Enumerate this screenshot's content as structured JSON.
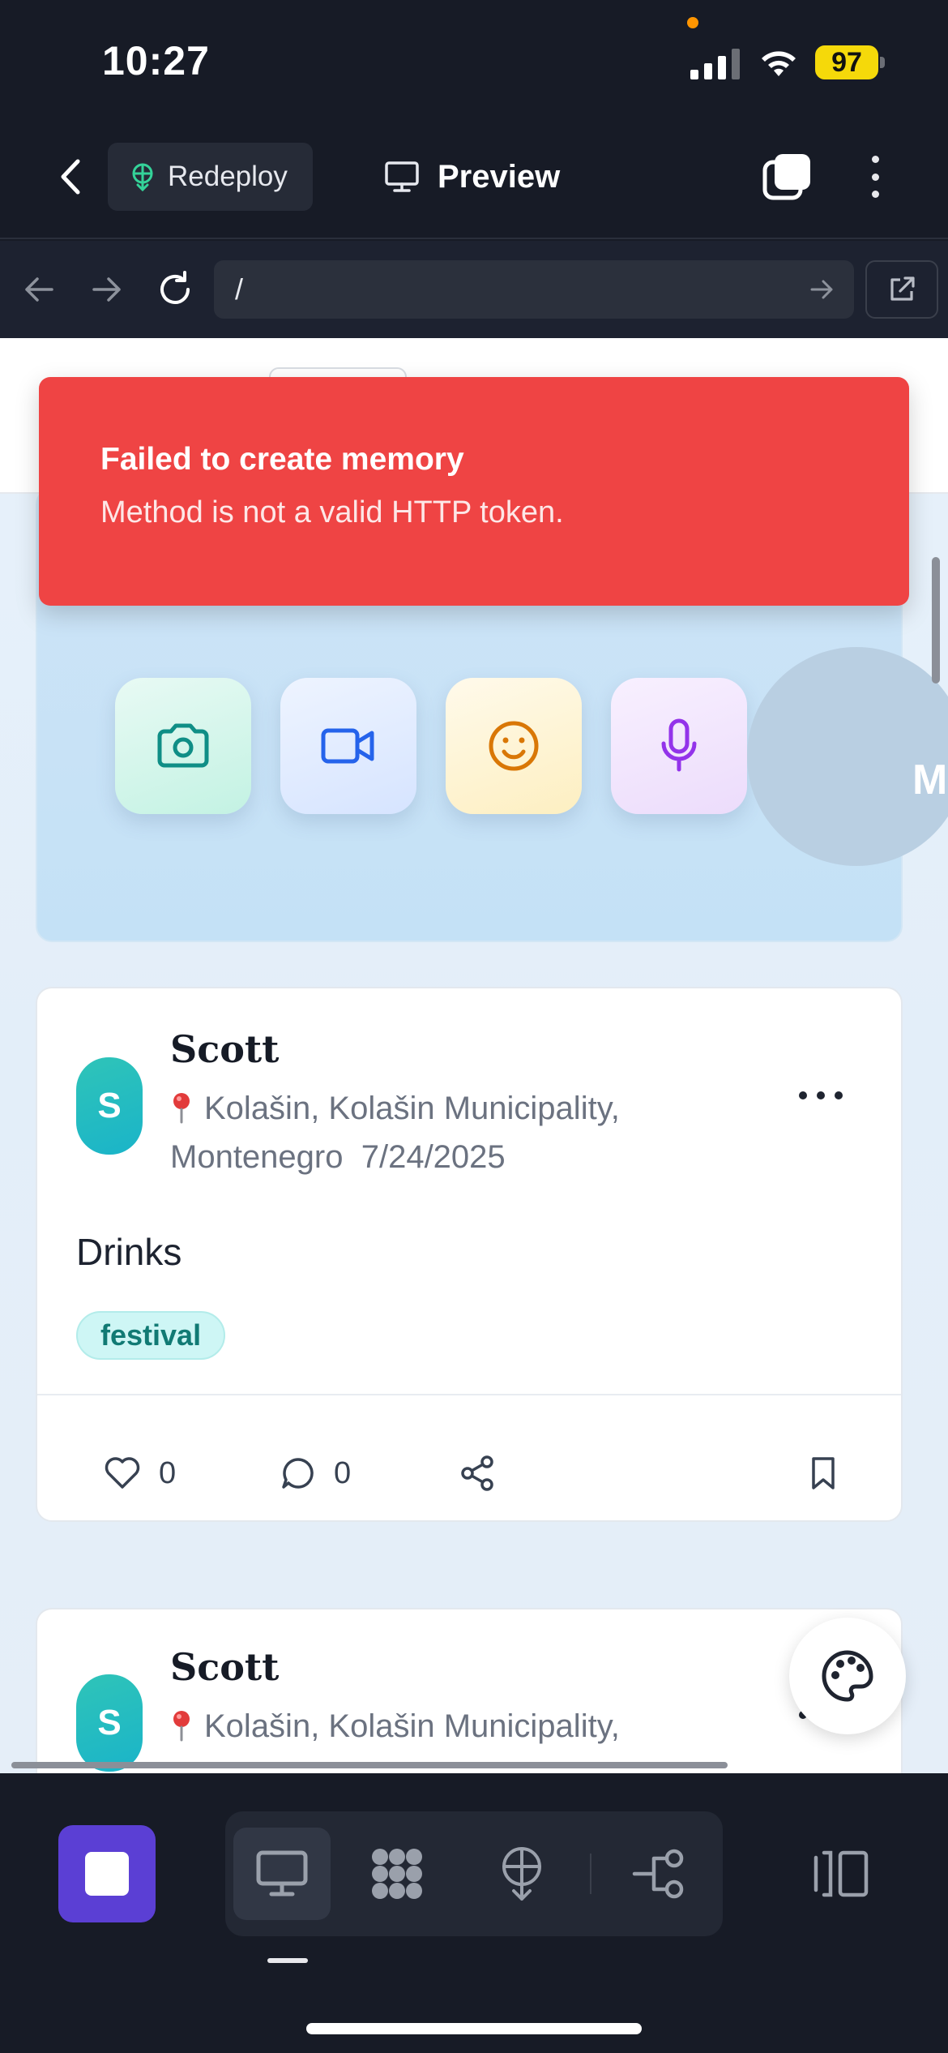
{
  "status_bar": {
    "time": "10:27",
    "battery": "97",
    "icons": [
      "signal-icon",
      "wifi-icon",
      "battery-icon"
    ]
  },
  "toolbar": {
    "redeploy_label": "Redeploy",
    "preview_label": "Preview",
    "icons": [
      "back-icon",
      "redeploy-icon",
      "monitor-icon",
      "tabs-icon",
      "more-icon"
    ]
  },
  "url_bar": {
    "url": "/",
    "icons": [
      "nav-back-icon",
      "nav-forward-icon",
      "reload-icon",
      "go-icon",
      "external-link-icon"
    ]
  },
  "toast": {
    "title": "Failed to create memory",
    "message": "Method is not a valid HTTP token.",
    "color": "#ef4444"
  },
  "composer": {
    "buttons": [
      "camera-icon",
      "video-icon",
      "smile-icon",
      "mic-icon"
    ],
    "circle_text": "M"
  },
  "posts": [
    {
      "avatar": "S",
      "author": "Scott",
      "location": "Kolašin, Kolašin Municipality, Montenegro",
      "date": "7/24/2025",
      "body": "Drinks",
      "tag": "festival",
      "likes": "0",
      "comments": "0"
    },
    {
      "avatar": "S",
      "author": "Scott",
      "location": "Kolašin, Kolašin Municipality,",
      "date": ""
    }
  ],
  "dock": {
    "stop_color": "#5b3fd4",
    "icons": [
      "stop-icon",
      "monitor-icon",
      "apps-icon",
      "deploy-icon",
      "workflow-icon",
      "panel-icon"
    ]
  }
}
